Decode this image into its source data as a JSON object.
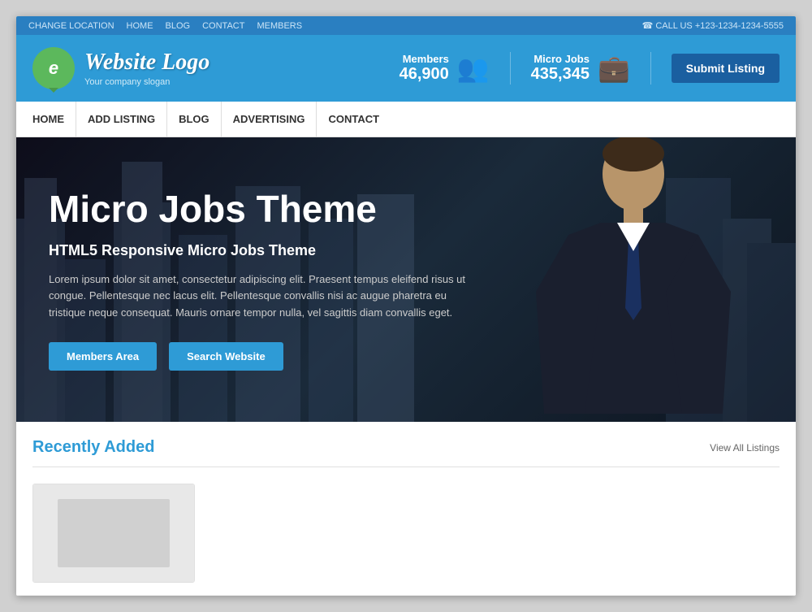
{
  "topbar": {
    "nav": [
      {
        "label": "CHANGE LOCATION",
        "href": "#"
      },
      {
        "label": "HOME",
        "href": "#"
      },
      {
        "label": "BLOG",
        "href": "#"
      },
      {
        "label": "CONTACT",
        "href": "#"
      },
      {
        "label": "MEMBERS",
        "href": "#"
      }
    ],
    "phone": "☎ CALL US +123-1234-1234-5555"
  },
  "header": {
    "logo_letter": "e",
    "logo_title": "Website Logo",
    "logo_slogan": "Your company slogan",
    "stats": {
      "members_label": "Members",
      "members_value": "46,900",
      "microjobs_label": "Micro Jobs",
      "microjobs_value": "435,345"
    },
    "submit_label": "Submit Listing"
  },
  "main_nav": [
    {
      "label": "HOME"
    },
    {
      "label": "ADD LISTING"
    },
    {
      "label": "BLOG"
    },
    {
      "label": "ADVERTISING"
    },
    {
      "label": "CONTACT"
    }
  ],
  "hero": {
    "title": "Micro Jobs Theme",
    "subtitle": "HTML5 Responsive Micro Jobs Theme",
    "text": "Lorem ipsum dolor sit amet, consectetur adipiscing elit. Praesent tempus eleifend risus ut congue. Pellentesque nec lacus elit. Pellentesque convallis nisi ac augue pharetra eu tristique neque consequat. Mauris ornare tempor nulla, vel sagittis diam convallis eget.",
    "btn1_label": "Members Area",
    "btn2_label": "Search Website"
  },
  "recently": {
    "title_highlight": "Recently",
    "title_rest": " Added",
    "view_all": "View All Listings"
  }
}
